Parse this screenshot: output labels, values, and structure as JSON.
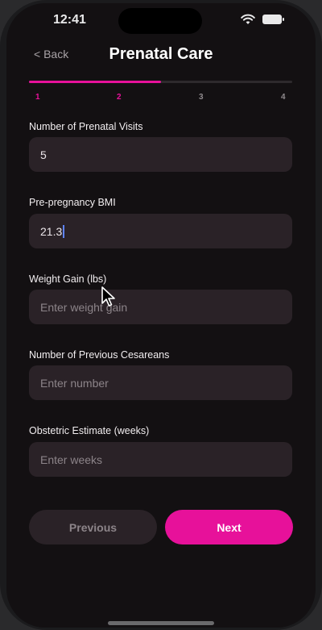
{
  "status_bar": {
    "time": "12:41"
  },
  "header": {
    "back_label": "< Back",
    "title": "Prenatal Care"
  },
  "progress": {
    "fraction": 0.5,
    "steps": [
      "1",
      "2",
      "3",
      "4"
    ],
    "active_steps": 2,
    "accent": "#e7119a"
  },
  "fields": [
    {
      "label": "Number of Prenatal Visits",
      "value": "5",
      "placeholder": ""
    },
    {
      "label": "Pre-pregnancy BMI",
      "value": "21.3",
      "placeholder": ""
    },
    {
      "label": "Weight Gain (lbs)",
      "value": "",
      "placeholder": "Enter weight gain"
    },
    {
      "label": "Number of Previous Cesareans",
      "value": "",
      "placeholder": "Enter number"
    },
    {
      "label": "Obstetric Estimate (weeks)",
      "value": "",
      "placeholder": "Enter weeks"
    }
  ],
  "buttons": {
    "previous": "Previous",
    "next": "Next"
  }
}
